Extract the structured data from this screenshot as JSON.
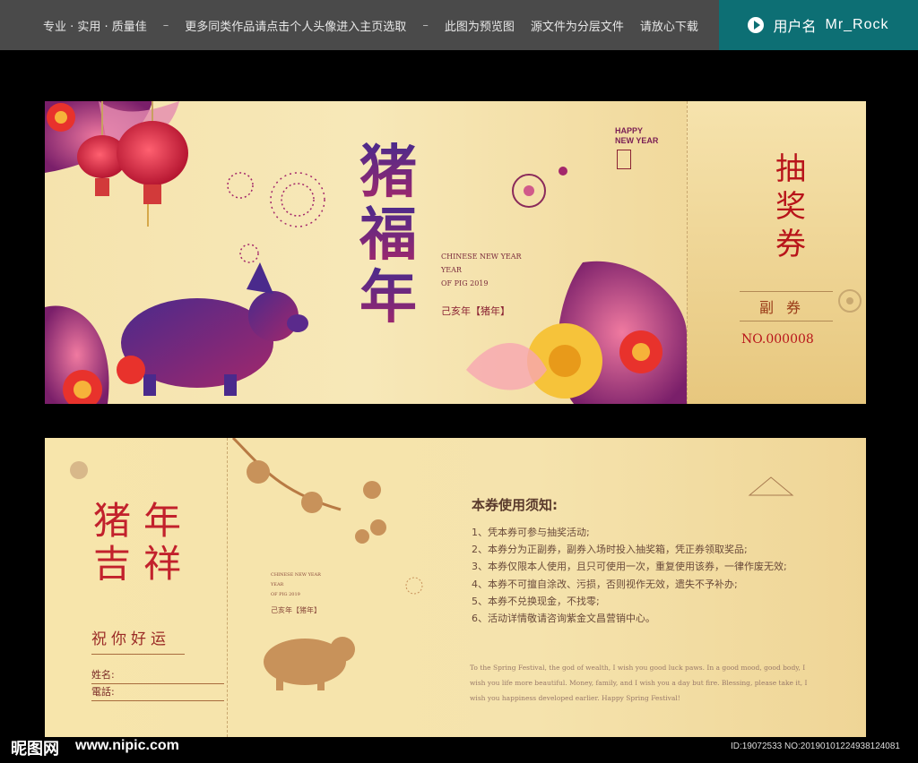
{
  "topbar": {
    "items": [
      "专业 · 实用 · 质量佳",
      "–",
      "更多同类作品请点击个人头像进入主页选取",
      "–",
      "此图为预览图",
      "源文件为分层文件",
      "请放心下载"
    ],
    "user_label": "用户名",
    "user_name": "Mr_Rock"
  },
  "front": {
    "title_chars": [
      "猪",
      "福",
      "年"
    ],
    "en_line1": "CHINESE NEW YEAR",
    "en_line2": "YEAR",
    "en_line3": "OF PIG 2019",
    "year_cn": "己亥年【猪年】",
    "happy_line1": "HAPPY",
    "happy_line2": "NEW YEAR",
    "stub_title": [
      "抽",
      "奖",
      "券"
    ],
    "stub_sub": "副券",
    "stub_no": "NO.000008"
  },
  "back": {
    "blessing_chars": [
      "猪",
      "年",
      "吉",
      "祥"
    ],
    "wish": "祝你好运",
    "name_label": "姓名:",
    "phone_label": "電話:",
    "en_line1": "CHINESE NEW YEAR",
    "en_line2": "YEAR",
    "en_line3": "OF PIG 2019",
    "year_cn": "己亥年【猪年】",
    "rules_title": "本券使用须知:",
    "rules": [
      "1、凭本券可参与抽奖活动;",
      "2、本券分为正副券，副券入场时投入抽奖箱，凭正券领取奖品;",
      "3、本券仅限本人使用，且只可使用一次，重复使用该券，一律作废无效;",
      "4、本券不可擅自涂改、污损，否则视作无效，遗失不予补办;",
      "5、本券不兑换现金，不找零;",
      "6、活动详情敬请咨询紫金文昌营销中心。"
    ],
    "english_text": "To the Spring Festival, the god of wealth, I wish you good luck paws. In a good mood, good body, I wish you life more beautiful. Money, family, and I wish you a day but fire. Blessing, please take it, I wish you happiness developed earlier. Happy Spring Festival!"
  },
  "watermark": {
    "logo": "昵图网",
    "url": "www.nipic.com",
    "id": "ID:19072533 NO:20190101224938124081"
  },
  "colors": {
    "topbar": "#4a4a4a",
    "user_badge": "#0d6f74",
    "gold": "#f5e3ad",
    "red": "#c2212c",
    "purple": "#4a2a8c"
  }
}
